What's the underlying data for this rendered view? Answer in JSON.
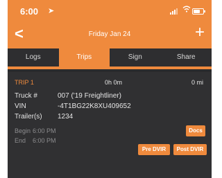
{
  "status_bar": {
    "time": "6:00",
    "location_glyph": "➤"
  },
  "nav": {
    "back_glyph": "<",
    "title": "Friday Jan 24",
    "add_glyph": "+"
  },
  "tabs": [
    {
      "label": "Logs",
      "active": false
    },
    {
      "label": "Trips",
      "active": true
    },
    {
      "label": "Sign",
      "active": false
    },
    {
      "label": "Share",
      "active": false
    }
  ],
  "trip": {
    "title": "TRIP 1",
    "duration": "0h 0m",
    "distance": "0 mi",
    "truck_label": "Truck #",
    "truck_value": "007 ('19 Freightliner)",
    "vin_label": "VIN",
    "vin_value": "-4T1BG22K8XU409652",
    "trailer_label": "Trailer(s)",
    "trailer_value": "1234",
    "begin_label": "Begin",
    "begin_value": "6:00 PM",
    "end_label": "End",
    "end_value": "6:00 PM"
  },
  "buttons": {
    "docs": "Docs",
    "pre_dvir": "Pre DVIR",
    "post_dvir": "Post DVIR"
  },
  "colors": {
    "accent": "#ef8a3d",
    "background": "#2a2a2c",
    "card": "#303032"
  }
}
